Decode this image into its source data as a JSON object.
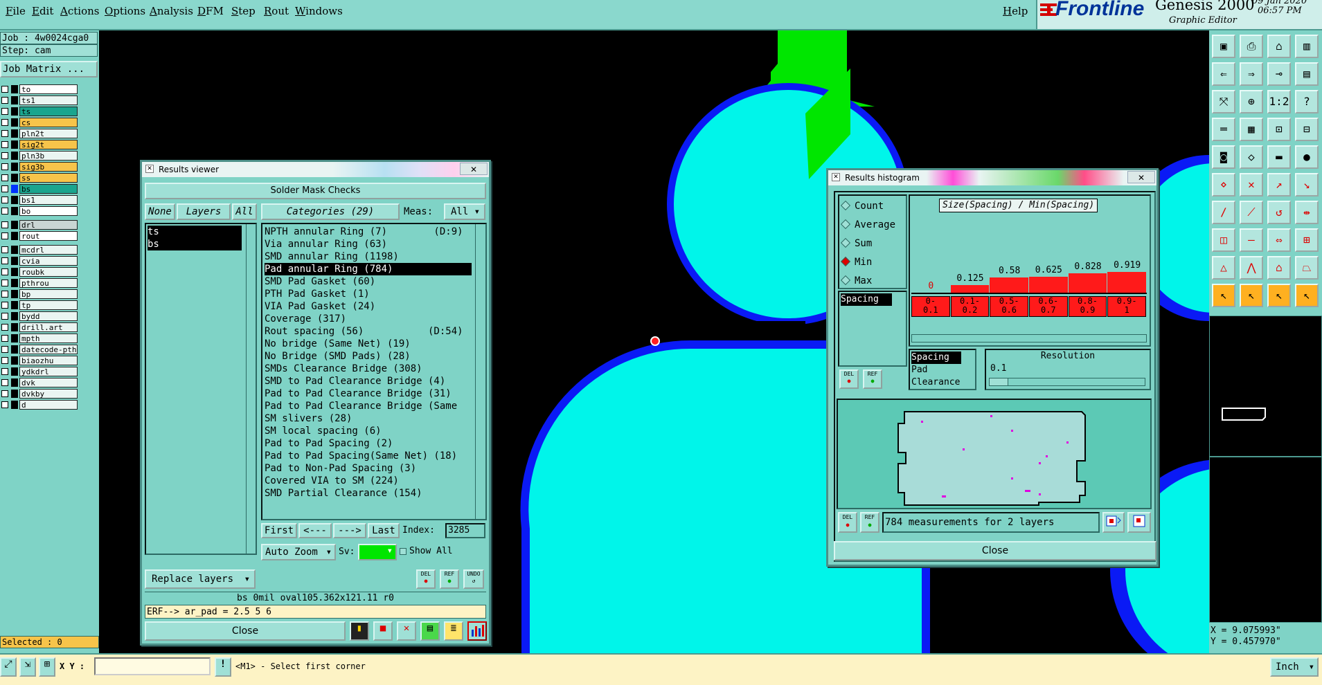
{
  "menu": [
    "File",
    "Edit",
    "Actions",
    "Options",
    "Analysis",
    "DFM",
    "Step",
    "Rout",
    "Windows"
  ],
  "help": "Help",
  "brand": {
    "logo": "Frontline",
    "product": "Genesis 2000",
    "subtitle": "Graphic Editor",
    "date": "09 Jan 2020",
    "time": "06:57 PM"
  },
  "left": {
    "job": "Job : 4w0024cga0",
    "step": "Step: cam",
    "job_matrix": "Job Matrix ...",
    "layers": [
      {
        "name": "to",
        "color": "#ffffff",
        "ind": "#000000"
      },
      {
        "name": "ts1",
        "color": "#eaf5f2",
        "ind": "#000000"
      },
      {
        "name": "ts",
        "color": "#1aa58e",
        "ind": "#000000"
      },
      {
        "name": "cs",
        "color": "#f7c44a",
        "ind": "#000000"
      },
      {
        "name": "pln2t",
        "color": "#eaf5f2",
        "ind": "#000000"
      },
      {
        "name": "sig2t",
        "color": "#f7c44a",
        "ind": "#000000"
      },
      {
        "name": "pln3b",
        "color": "#eaf5f2",
        "ind": "#000000"
      },
      {
        "name": "sig3b",
        "color": "#f7c44a",
        "ind": "#000000"
      },
      {
        "name": "ss",
        "color": "#f7c44a",
        "ind": "#000000"
      },
      {
        "name": "bs",
        "color": "#1aa58e",
        "ind": "#0033ff"
      },
      {
        "name": "bs1",
        "color": "#eaf5f2",
        "ind": "#000000"
      },
      {
        "name": "bo",
        "color": "#ffffff",
        "ind": "#000000"
      },
      {
        "name": "drl",
        "color": "#c9d5d3",
        "ind": "#000000"
      },
      {
        "name": "rout",
        "color": "#ffffff",
        "ind": "#000000"
      },
      {
        "name": "mcdrl",
        "color": "#eaf5f2",
        "ind": "#000000"
      },
      {
        "name": "cvia",
        "color": "#eaf5f2",
        "ind": "#000000"
      },
      {
        "name": "roubk",
        "color": "#eaf5f2",
        "ind": "#000000"
      },
      {
        "name": "pthrou",
        "color": "#eaf5f2",
        "ind": "#000000"
      },
      {
        "name": "bp",
        "color": "#eaf5f2",
        "ind": "#000000"
      },
      {
        "name": "tp",
        "color": "#eaf5f2",
        "ind": "#000000"
      },
      {
        "name": "bydd",
        "color": "#eaf5f2",
        "ind": "#000000"
      },
      {
        "name": "drill.art",
        "color": "#eaf5f2",
        "ind": "#000000"
      },
      {
        "name": "mpth",
        "color": "#eaf5f2",
        "ind": "#000000"
      },
      {
        "name": "datecode-pth",
        "color": "#eaf5f2",
        "ind": "#000000"
      },
      {
        "name": "biaozhu",
        "color": "#eaf5f2",
        "ind": "#000000"
      },
      {
        "name": "ydkdrl",
        "color": "#eaf5f2",
        "ind": "#000000"
      },
      {
        "name": "dvk",
        "color": "#eaf5f2",
        "ind": "#000000"
      },
      {
        "name": "dvkby",
        "color": "#eaf5f2",
        "ind": "#000000"
      },
      {
        "name": "d",
        "color": "#eaf5f2",
        "ind": "#000000"
      }
    ],
    "selected": "Selected : 0"
  },
  "results_viewer": {
    "title": "Results viewer",
    "header": "Solder Mask Checks",
    "none": "None",
    "layers_label": "Layers",
    "all": "All",
    "categories": "Categories (29)",
    "meas_label": "Meas:",
    "meas_value": "All",
    "layers": [
      "ts",
      "bs"
    ],
    "items": [
      "NPTH annular Ring (7)        (D:9)",
      "Via annular Ring (63)",
      "SMD annular Ring (1198)",
      "Pad annular Ring (784)",
      "SMD Pad Gasket (60)",
      "PTH Pad Gasket (1)",
      "VIA Pad Gasket (24)",
      "Coverage (317)",
      "Rout spacing (56)           (D:54)",
      "No bridge (Same Net) (19)",
      "No Bridge (SMD Pads) (28)",
      "SMDs Clearance Bridge (308)",
      "SMD to Pad Clearance Bridge (4)",
      "Pad to Pad Clearance Bridge (31)",
      "Pad to Pad Clearance Bridge (Same",
      "SM slivers (28)",
      "SM local spacing (6)",
      "Pad to Pad Spacing (2)",
      "Pad to Pad Spacing(Same Net) (18)",
      "Pad to Non-Pad Spacing (3)",
      "Covered VIA to SM (224)",
      "SMD Partial Clearance (154)"
    ],
    "selected_index": 3,
    "first": "First",
    "prev": "<---",
    "next": "--->",
    "last": "Last",
    "index_label": "Index:",
    "index_value": "3285",
    "auto_zoom": "Auto Zoom",
    "sv": "Sv:",
    "show_all": "Show All",
    "replace_layers": "Replace layers",
    "del": "DEL",
    "ref": "REF",
    "undo": "UNDO",
    "info": "bs  0mil   oval105.362x121.11   r0",
    "erf": "ERF--> ar_pad = 2.5 5 6",
    "close": "Close"
  },
  "histogram": {
    "title": "Results histogram",
    "modes": [
      "Count",
      "Average",
      "Sum",
      "Min",
      "Max"
    ],
    "active_mode": "Min",
    "caption": "Size(Spacing) / Min(Spacing)",
    "bins": [
      {
        "label": "0-\n0.1",
        "value": "0",
        "fill": 0
      },
      {
        "label": "0.1-\n0.2",
        "value": "0.125",
        "fill": 0.136
      },
      {
        "label": "0.5-\n0.6",
        "value": "0.58",
        "fill": 0.631
      },
      {
        "label": "0.6-\n0.7",
        "value": "0.625",
        "fill": 0.68
      },
      {
        "label": "0.8-\n0.9",
        "value": "0.828",
        "fill": 0.9
      },
      {
        "label": "0.9-\n1",
        "value": "0.919",
        "fill": 1.0
      }
    ],
    "measure_list": [
      "Spacing"
    ],
    "type_list": [
      "Spacing",
      "Pad",
      "Clearance"
    ],
    "resolution_label": "Resolution",
    "resolution_value": "0.1",
    "del": "DEL",
    "ref": "REF",
    "summary": "784 measurements for 2 layers",
    "close": "Close"
  },
  "coords": {
    "x": "X = 9.075993\"",
    "y": "Y = 0.457970\""
  },
  "status": {
    "xy_label": "X Y :",
    "xy_value": "",
    "message": "<M1> - Select first corner",
    "unit": "Inch"
  },
  "colors": {
    "panel": "#7fd3c6",
    "pad": "#00f5ea",
    "mask": "#0a1af5",
    "copper": "#00e600",
    "bar": "#ff1a1a",
    "bg": "#000000"
  }
}
